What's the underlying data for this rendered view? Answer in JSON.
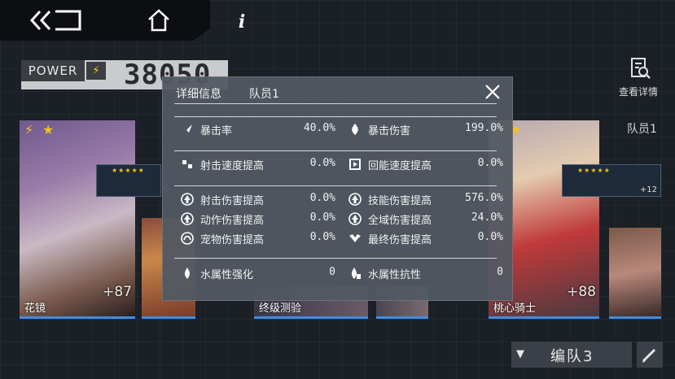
{
  "power": {
    "label": "POWER",
    "value": "38050"
  },
  "view_detail": {
    "label": "查看详情"
  },
  "team_member_right": "队员1",
  "characters": {
    "left_name": "花镜",
    "left_level": "+87",
    "mid_b_name": "终级测验",
    "right_name": "桃心骑士",
    "right_level": "+88",
    "weapon_right_bonus": "+12"
  },
  "team_select": {
    "label": "编队3"
  },
  "panel": {
    "title": "详细信息",
    "member": "队员1",
    "stats": [
      {
        "label": "暴击率",
        "value": "40.0%",
        "icon": "crit-rate-icon"
      },
      {
        "label": "暴击伤害",
        "value": "199.0%",
        "icon": "crit-damage-icon"
      },
      {
        "label": "射击速度提高",
        "value": "0.0%",
        "icon": "fire-rate-icon"
      },
      {
        "label": "回能速度提高",
        "value": "0.0%",
        "icon": "energy-regen-icon"
      },
      {
        "label": "射击伤害提高",
        "value": "0.0%",
        "icon": "shot-damage-icon"
      },
      {
        "label": "技能伤害提高",
        "value": "576.0%",
        "icon": "skill-damage-icon"
      },
      {
        "label": "动作伤害提高",
        "value": "0.0%",
        "icon": "action-damage-icon"
      },
      {
        "label": "全域伤害提高",
        "value": "24.0%",
        "icon": "global-damage-icon"
      },
      {
        "label": "宠物伤害提高",
        "value": "0.0%",
        "icon": "pet-damage-icon"
      },
      {
        "label": "最终伤害提高",
        "value": "0.0%",
        "icon": "final-damage-icon"
      },
      {
        "label": "水属性强化",
        "value": "0",
        "icon": "water-boost-icon"
      },
      {
        "label": "水属性抗性",
        "value": "0",
        "icon": "water-resist-icon"
      }
    ]
  },
  "colors": {
    "accent_gold": "#f5c21b",
    "card_underline": "#3a8ee8",
    "panel_bg": "#525862"
  }
}
